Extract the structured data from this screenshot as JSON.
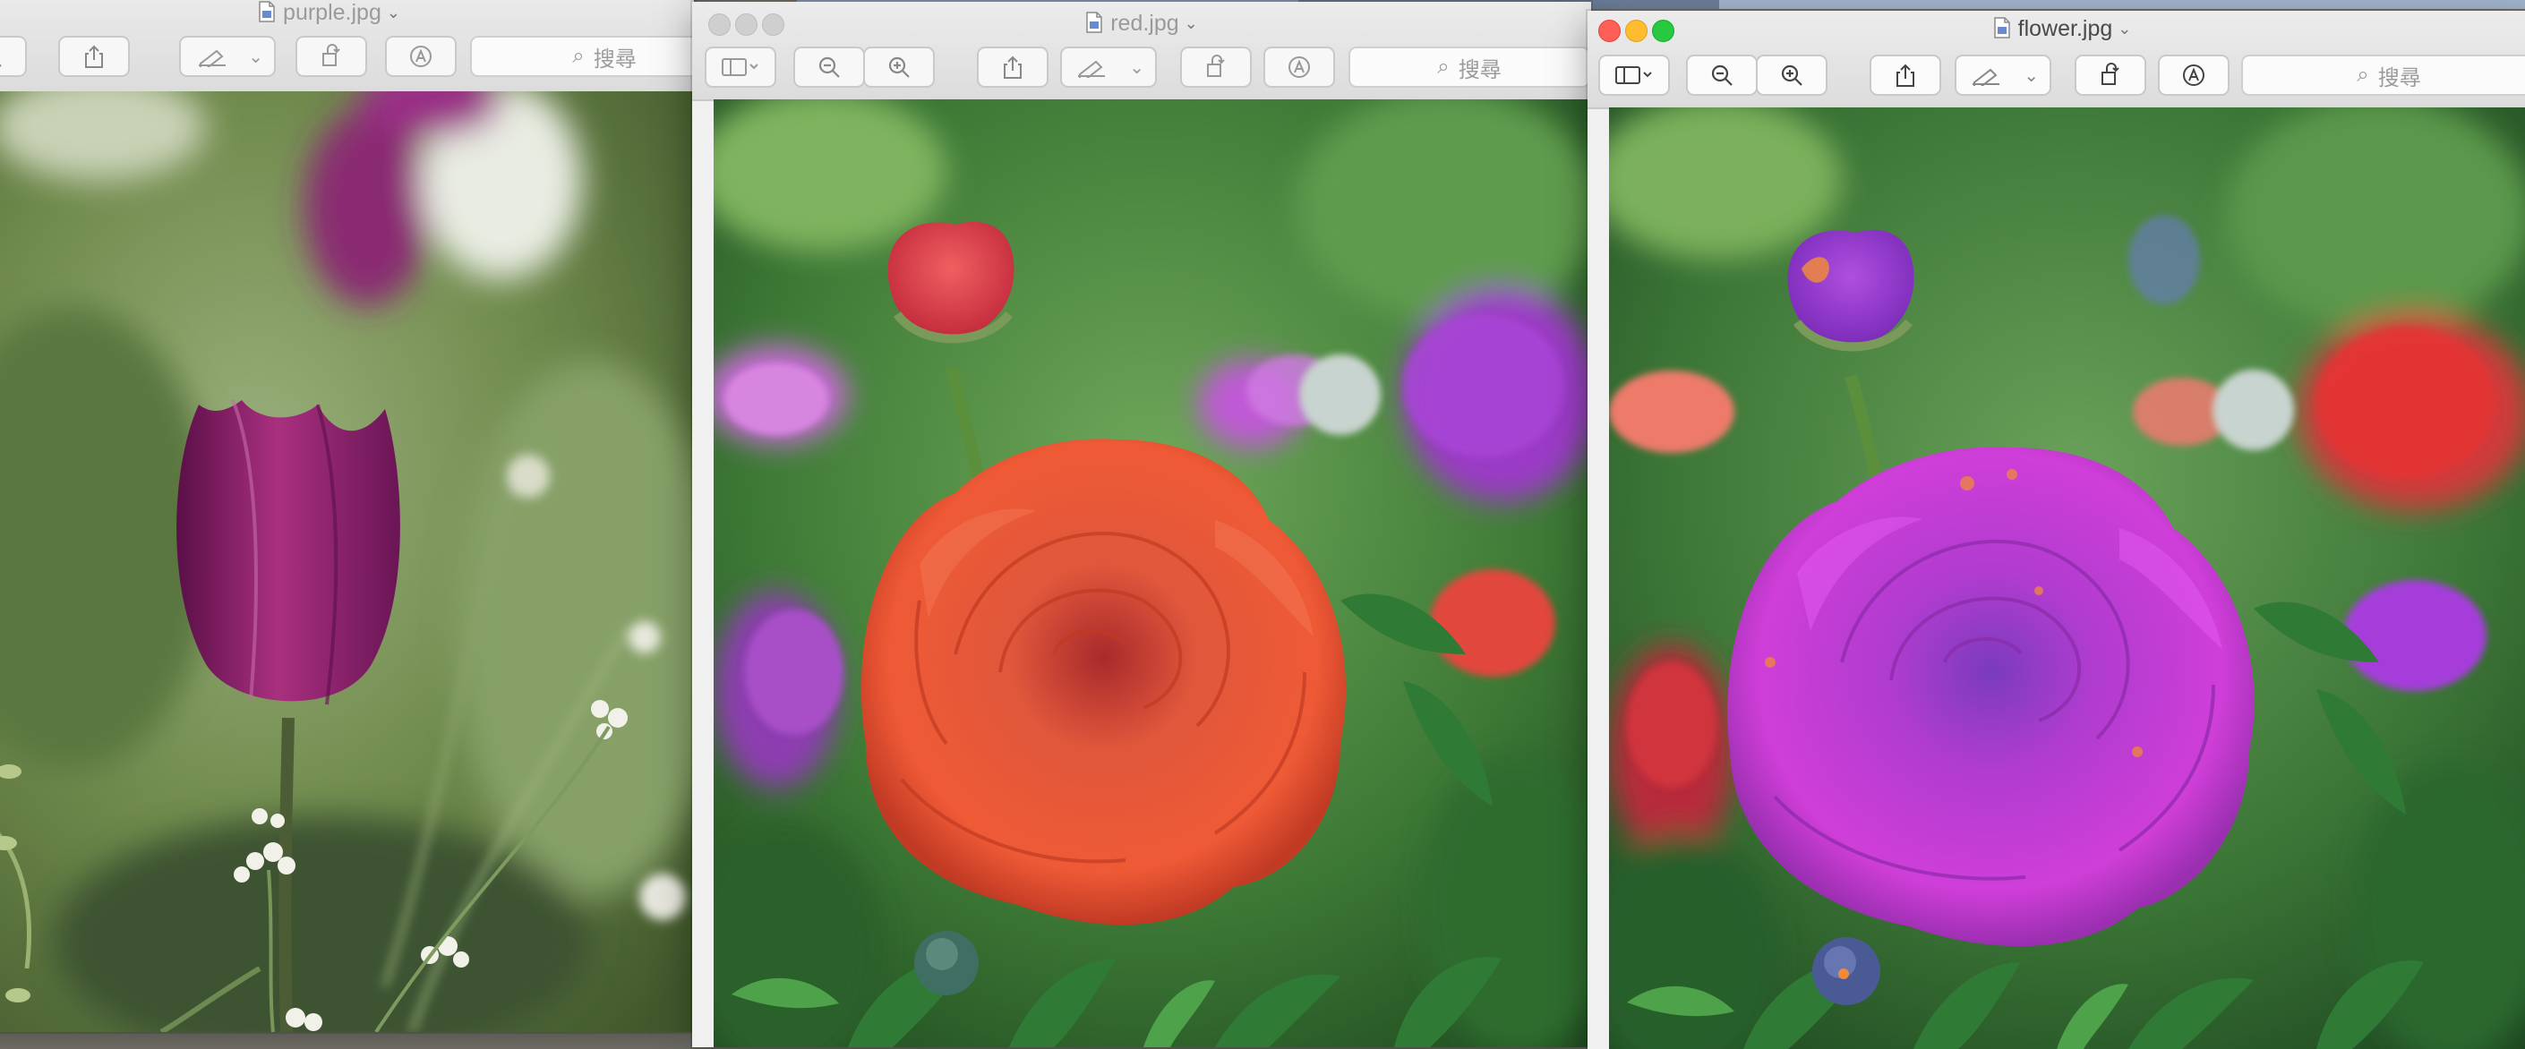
{
  "windows": [
    {
      "id": "purple",
      "title": "purple.jpg",
      "active": false,
      "search_placeholder": "搜尋",
      "photo": "purple-tulip"
    },
    {
      "id": "red",
      "title": "red.jpg",
      "active": false,
      "search_placeholder": "搜尋",
      "photo": "red-ranunculus"
    },
    {
      "id": "flower",
      "title": "flower.jpg",
      "active": true,
      "search_placeholder": "搜尋",
      "photo": "magenta-ranunculus"
    }
  ],
  "icons": [
    "sidebar-icon",
    "zoom-out-icon",
    "zoom-in-icon",
    "share-icon",
    "markup-pen-icon",
    "rotate-icon",
    "annotate-icon",
    "search-icon",
    "document-icon"
  ],
  "colors": {
    "close": "#fe5f57",
    "minimize": "#febc2e",
    "zoom": "#28c840",
    "tulip": "#8b1e6e",
    "rose_red": "#e5452c",
    "rose_magenta": "#c93ad3"
  }
}
